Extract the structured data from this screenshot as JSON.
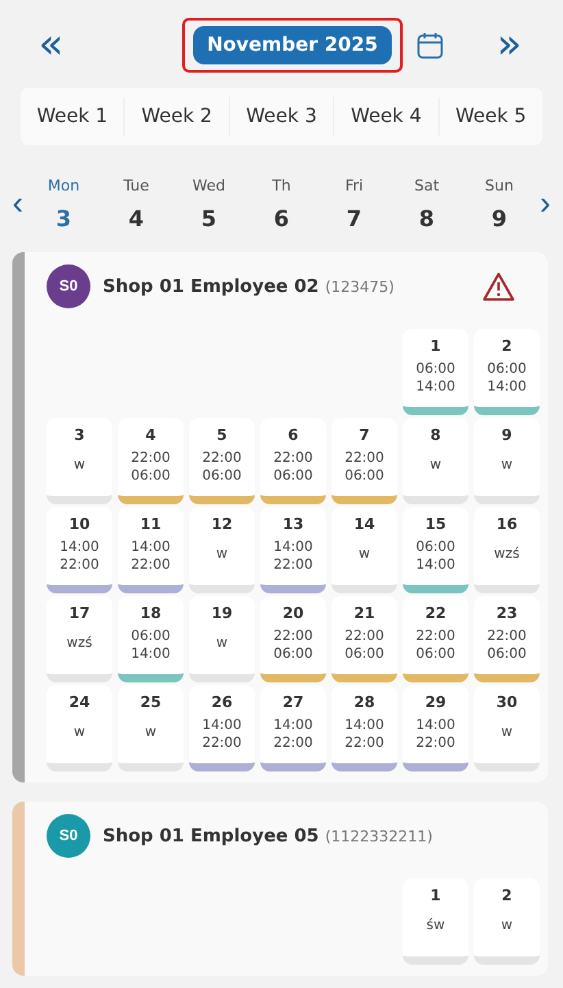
{
  "header": {
    "prev": "«",
    "title": "November 2025",
    "next": "»"
  },
  "week_tabs": [
    {
      "label": "Week 1"
    },
    {
      "label": "Week 2"
    },
    {
      "label": "Week 3"
    },
    {
      "label": "Week 4"
    },
    {
      "label": "Week 5"
    }
  ],
  "day_strip": {
    "prev": "‹",
    "next": "›",
    "days": [
      {
        "name": "Mon",
        "date": "3",
        "selected": true
      },
      {
        "name": "Tue",
        "date": "4",
        "selected": false
      },
      {
        "name": "Wed",
        "date": "5",
        "selected": false
      },
      {
        "name": "Th",
        "date": "6",
        "selected": false
      },
      {
        "name": "Fri",
        "date": "7",
        "selected": false
      },
      {
        "name": "Sat",
        "date": "8",
        "selected": false
      },
      {
        "name": "Sun",
        "date": "9",
        "selected": false
      }
    ]
  },
  "employees": [
    {
      "avatar": {
        "text": "S0",
        "color": "#6a3d8f"
      },
      "stripe": {
        "color": "#a6a6a6"
      },
      "name": "Shop 01 Employee 02",
      "code": "(123475)",
      "warning": true,
      "weeks": [
        {
          "days": [
            {
              "kind": "blank"
            },
            {
              "kind": "blank"
            },
            {
              "kind": "blank"
            },
            {
              "kind": "blank"
            },
            {
              "kind": "blank"
            },
            {
              "kind": "shift",
              "day": "1",
              "start": "06:00",
              "end": "14:00",
              "color": "#7cc4bf"
            },
            {
              "kind": "shift",
              "day": "2",
              "start": "06:00",
              "end": "14:00",
              "color": "#7cc4bf"
            }
          ]
        },
        {
          "days": [
            {
              "kind": "off",
              "day": "3",
              "code": "w",
              "color": "#e4e4e4"
            },
            {
              "kind": "shift",
              "day": "4",
              "start": "22:00",
              "end": "06:00",
              "color": "#e2b865"
            },
            {
              "kind": "shift",
              "day": "5",
              "start": "22:00",
              "end": "06:00",
              "color": "#e2b865"
            },
            {
              "kind": "shift",
              "day": "6",
              "start": "22:00",
              "end": "06:00",
              "color": "#e2b865"
            },
            {
              "kind": "shift",
              "day": "7",
              "start": "22:00",
              "end": "06:00",
              "color": "#e2b865"
            },
            {
              "kind": "off",
              "day": "8",
              "code": "w",
              "color": "#e4e4e4"
            },
            {
              "kind": "off",
              "day": "9",
              "code": "w",
              "color": "#e4e4e4"
            }
          ]
        },
        {
          "days": [
            {
              "kind": "shift",
              "day": "10",
              "start": "14:00",
              "end": "22:00",
              "color": "#aeafd6"
            },
            {
              "kind": "shift",
              "day": "11",
              "start": "14:00",
              "end": "22:00",
              "color": "#aeafd6"
            },
            {
              "kind": "off",
              "day": "12",
              "code": "w",
              "color": "#e4e4e4"
            },
            {
              "kind": "shift",
              "day": "13",
              "start": "14:00",
              "end": "22:00",
              "color": "#aeafd6"
            },
            {
              "kind": "off",
              "day": "14",
              "code": "w",
              "color": "#e4e4e4"
            },
            {
              "kind": "shift",
              "day": "15",
              "start": "06:00",
              "end": "14:00",
              "color": "#7cc4bf"
            },
            {
              "kind": "off",
              "day": "16",
              "code": "wzś",
              "color": "#e4e4e4"
            }
          ]
        },
        {
          "days": [
            {
              "kind": "off",
              "day": "17",
              "code": "wzś",
              "color": "#e4e4e4"
            },
            {
              "kind": "shift",
              "day": "18",
              "start": "06:00",
              "end": "14:00",
              "color": "#7cc4bf"
            },
            {
              "kind": "off",
              "day": "19",
              "code": "w",
              "color": "#e4e4e4"
            },
            {
              "kind": "shift",
              "day": "20",
              "start": "22:00",
              "end": "06:00",
              "color": "#e2b865"
            },
            {
              "kind": "shift",
              "day": "21",
              "start": "22:00",
              "end": "06:00",
              "color": "#e2b865"
            },
            {
              "kind": "shift",
              "day": "22",
              "start": "22:00",
              "end": "06:00",
              "color": "#e2b865"
            },
            {
              "kind": "shift",
              "day": "23",
              "start": "22:00",
              "end": "06:00",
              "color": "#e2b865"
            }
          ]
        },
        {
          "days": [
            {
              "kind": "off",
              "day": "24",
              "code": "w",
              "color": "#e4e4e4"
            },
            {
              "kind": "off",
              "day": "25",
              "code": "w",
              "color": "#e4e4e4"
            },
            {
              "kind": "shift",
              "day": "26",
              "start": "14:00",
              "end": "22:00",
              "color": "#aeafd6"
            },
            {
              "kind": "shift",
              "day": "27",
              "start": "14:00",
              "end": "22:00",
              "color": "#aeafd6"
            },
            {
              "kind": "shift",
              "day": "28",
              "start": "14:00",
              "end": "22:00",
              "color": "#aeafd6"
            },
            {
              "kind": "shift",
              "day": "29",
              "start": "14:00",
              "end": "22:00",
              "color": "#aeafd6"
            },
            {
              "kind": "off",
              "day": "30",
              "code": "w",
              "color": "#e4e4e4"
            }
          ]
        }
      ]
    },
    {
      "avatar": {
        "text": "S0",
        "color": "#1a9aa8"
      },
      "stripe": {
        "color": "#ebc9a8"
      },
      "name": "Shop 01 Employee 05",
      "code": "(1122332211)",
      "warning": false,
      "weeks": [
        {
          "days": [
            {
              "kind": "blank"
            },
            {
              "kind": "blank"
            },
            {
              "kind": "blank"
            },
            {
              "kind": "blank"
            },
            {
              "kind": "blank"
            },
            {
              "kind": "off",
              "day": "1",
              "code": "św",
              "color": "#e4e4e4"
            },
            {
              "kind": "off",
              "day": "2",
              "code": "w",
              "color": "#e4e4e4"
            }
          ]
        }
      ]
    }
  ]
}
